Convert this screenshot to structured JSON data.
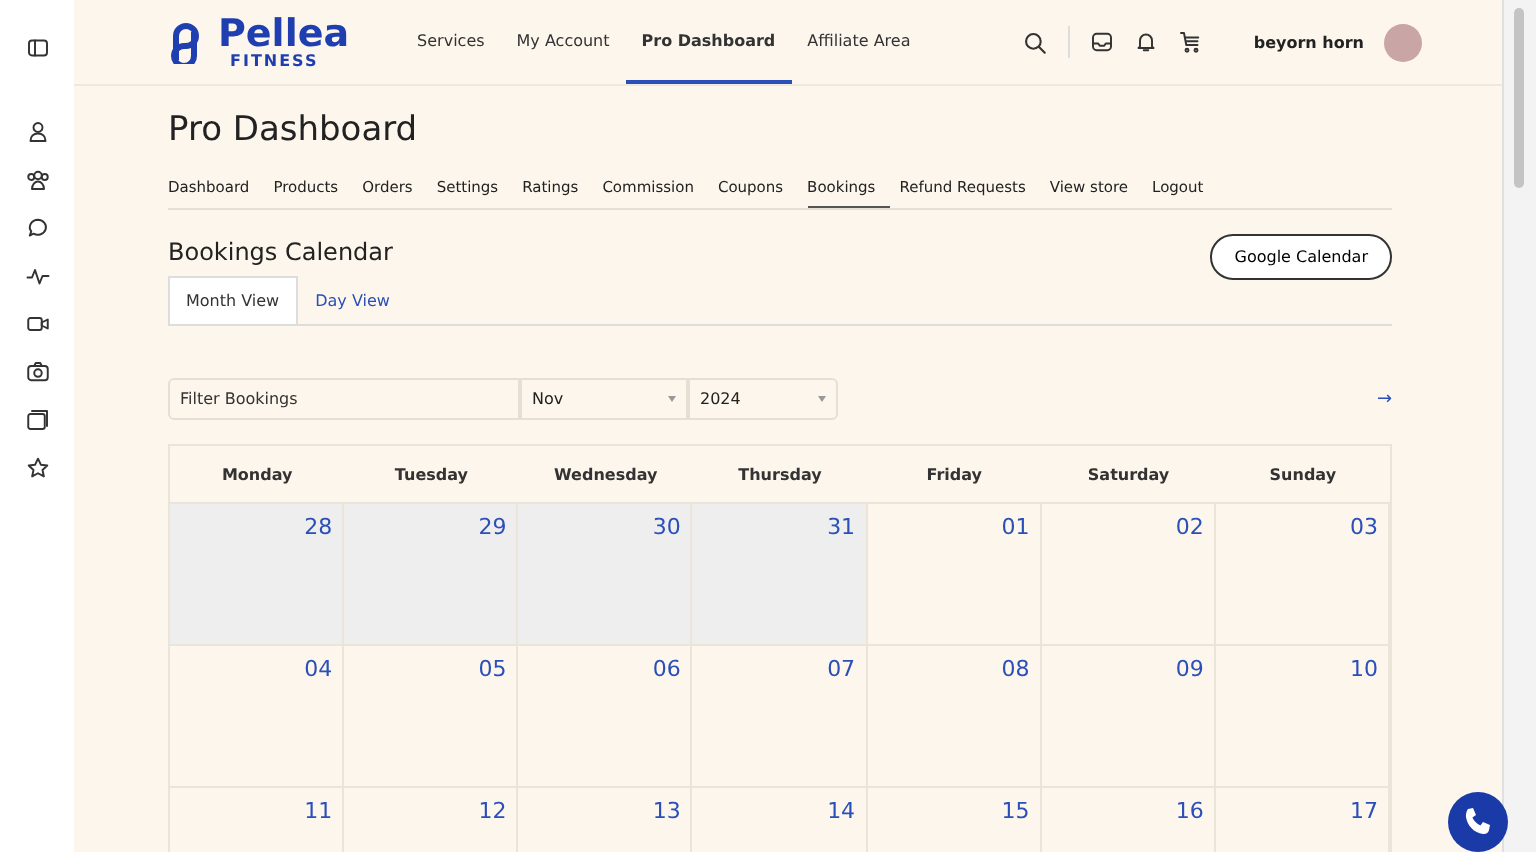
{
  "logo": {
    "name": "Pellea",
    "tagline": "FITNESS"
  },
  "nav": [
    {
      "label": "Services",
      "selected": false
    },
    {
      "label": "My Account",
      "selected": false
    },
    {
      "label": "Pro Dashboard",
      "selected": true
    },
    {
      "label": "Affiliate Area",
      "selected": false
    }
  ],
  "user": {
    "name": "beyorn horn"
  },
  "page_title": "Pro Dashboard",
  "tabs": [
    {
      "label": "Dashboard",
      "selected": false
    },
    {
      "label": "Products",
      "selected": false
    },
    {
      "label": "Orders",
      "selected": false
    },
    {
      "label": "Settings",
      "selected": false
    },
    {
      "label": "Ratings",
      "selected": false
    },
    {
      "label": "Commission",
      "selected": false
    },
    {
      "label": "Coupons",
      "selected": false
    },
    {
      "label": "Bookings",
      "selected": true
    },
    {
      "label": "Refund Requests",
      "selected": false
    },
    {
      "label": "View store",
      "selected": false
    },
    {
      "label": "Logout",
      "selected": false
    }
  ],
  "section_title": "Bookings Calendar",
  "google_button": "Google Calendar",
  "view_tabs": [
    {
      "label": "Month View",
      "selected": true
    },
    {
      "label": "Day View",
      "selected": false
    }
  ],
  "filter": {
    "placeholder": "Filter Bookings",
    "month": "Nov",
    "year": "2024",
    "next": "→"
  },
  "weekdays": [
    "Monday",
    "Tuesday",
    "Wednesday",
    "Thursday",
    "Friday",
    "Saturday",
    "Sunday"
  ],
  "weeks": [
    [
      {
        "day": "28",
        "outside": true
      },
      {
        "day": "29",
        "outside": true
      },
      {
        "day": "30",
        "outside": true
      },
      {
        "day": "31",
        "outside": true
      },
      {
        "day": "01",
        "outside": false
      },
      {
        "day": "02",
        "outside": false
      },
      {
        "day": "03",
        "outside": false
      }
    ],
    [
      {
        "day": "04",
        "outside": false
      },
      {
        "day": "05",
        "outside": false
      },
      {
        "day": "06",
        "outside": false
      },
      {
        "day": "07",
        "outside": false
      },
      {
        "day": "08",
        "outside": false
      },
      {
        "day": "09",
        "outside": false
      },
      {
        "day": "10",
        "outside": false
      }
    ],
    [
      {
        "day": "11",
        "outside": false
      },
      {
        "day": "12",
        "outside": false
      },
      {
        "day": "13",
        "outside": false
      },
      {
        "day": "14",
        "outside": false
      },
      {
        "day": "15",
        "outside": false
      },
      {
        "day": "16",
        "outside": false
      },
      {
        "day": "17",
        "outside": false
      }
    ]
  ]
}
